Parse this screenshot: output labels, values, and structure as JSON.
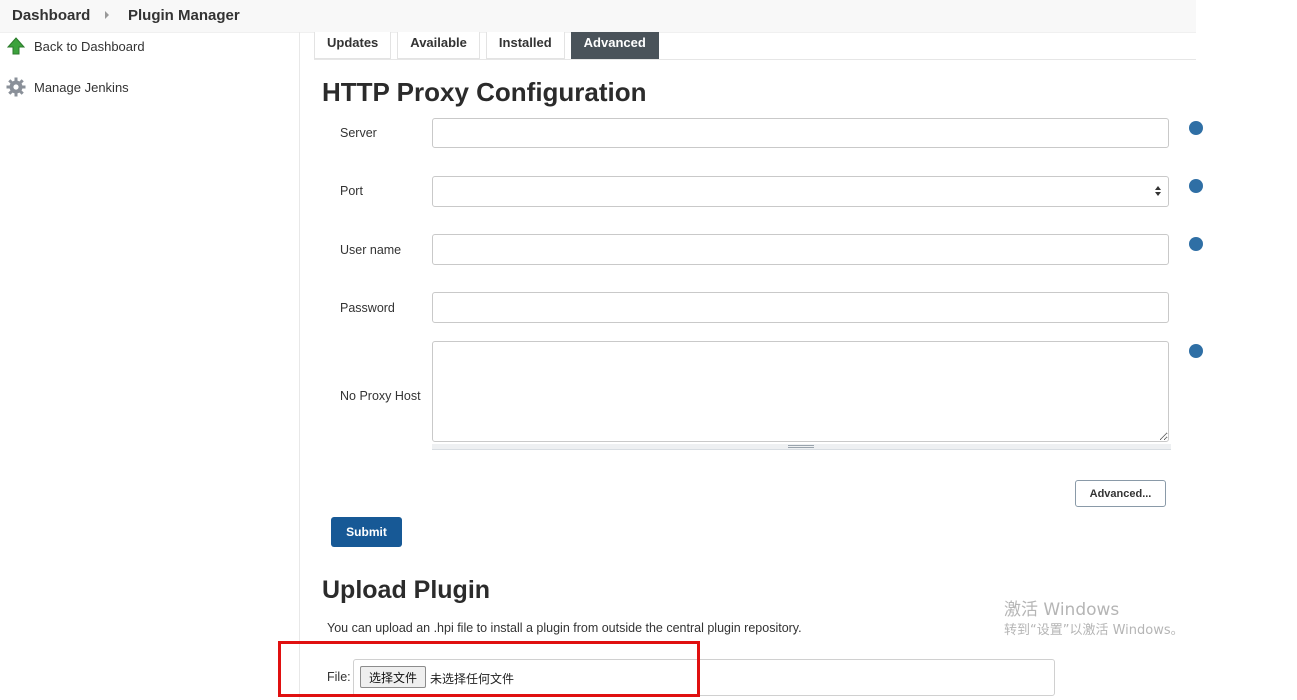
{
  "breadcrumb": {
    "items": [
      "Dashboard",
      "Plugin Manager"
    ]
  },
  "sidebar": {
    "items": [
      {
        "label": "Back to Dashboard",
        "icon": "up-arrow-icon"
      },
      {
        "label": "Manage Jenkins",
        "icon": "gear-icon"
      }
    ]
  },
  "tabs": [
    {
      "label": "Updates",
      "active": false
    },
    {
      "label": "Available",
      "active": false
    },
    {
      "label": "Installed",
      "active": false
    },
    {
      "label": "Advanced",
      "active": true
    }
  ],
  "proxy": {
    "title": "HTTP Proxy Configuration",
    "fields": {
      "server": {
        "label": "Server",
        "value": ""
      },
      "port": {
        "label": "Port",
        "value": ""
      },
      "username": {
        "label": "User name",
        "value": ""
      },
      "password": {
        "label": "Password",
        "value": ""
      },
      "no_proxy_host": {
        "label": "No Proxy Host",
        "value": ""
      }
    },
    "advanced_label": "Advanced...",
    "submit_label": "Submit"
  },
  "upload": {
    "title": "Upload Plugin",
    "description": "You can upload an .hpi file to install a plugin from outside the central plugin repository.",
    "file_label": "File:",
    "choose_button": "选择文件",
    "no_file_text": "未选择任何文件"
  },
  "watermark": {
    "line1": "激活 Windows",
    "line2": "转到“设置”以激活 Windows。"
  },
  "colors": {
    "active_tab": "#4a535a",
    "submit": "#175996",
    "help_icon": "#2f6fa5",
    "highlight": "#e01010"
  }
}
